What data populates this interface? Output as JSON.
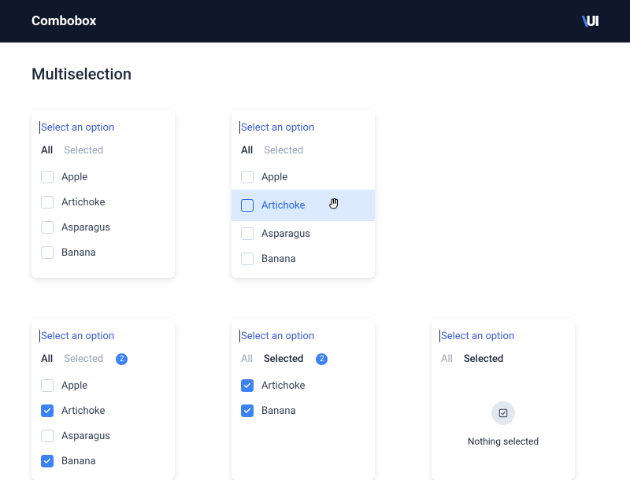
{
  "header": {
    "title": "Combobox",
    "logo": "UI"
  },
  "section_title": "Multiselection",
  "placeholder": "Select an option",
  "tabs": {
    "all": "All",
    "selected": "Selected"
  },
  "empty_text": "Nothing selected",
  "panels": [
    {
      "active_tab": "all",
      "badge": null,
      "options": [
        {
          "label": "Apple",
          "checked": false,
          "hovered": false
        },
        {
          "label": "Artichoke",
          "checked": false,
          "hovered": false
        },
        {
          "label": "Asparagus",
          "checked": false,
          "hovered": false
        },
        {
          "label": "Banana",
          "checked": false,
          "hovered": false
        }
      ]
    },
    {
      "active_tab": "all",
      "badge": null,
      "show_cursor": true,
      "options": [
        {
          "label": "Apple",
          "checked": false,
          "hovered": false
        },
        {
          "label": "Artichoke",
          "checked": false,
          "hovered": true
        },
        {
          "label": "Asparagus",
          "checked": false,
          "hovered": false
        },
        {
          "label": "Banana",
          "checked": false,
          "hovered": false
        }
      ]
    },
    null,
    {
      "active_tab": "all",
      "badge": 2,
      "options": [
        {
          "label": "Apple",
          "checked": false,
          "hovered": false
        },
        {
          "label": "Artichoke",
          "checked": true,
          "hovered": false
        },
        {
          "label": "Asparagus",
          "checked": false,
          "hovered": false
        },
        {
          "label": "Banana",
          "checked": true,
          "hovered": false
        }
      ]
    },
    {
      "active_tab": "selected",
      "badge": 2,
      "options": [
        {
          "label": "Artichoke",
          "checked": true,
          "hovered": false
        },
        {
          "label": "Banana",
          "checked": true,
          "hovered": false
        }
      ]
    },
    {
      "active_tab": "selected",
      "badge": null,
      "empty": true,
      "options": []
    }
  ]
}
